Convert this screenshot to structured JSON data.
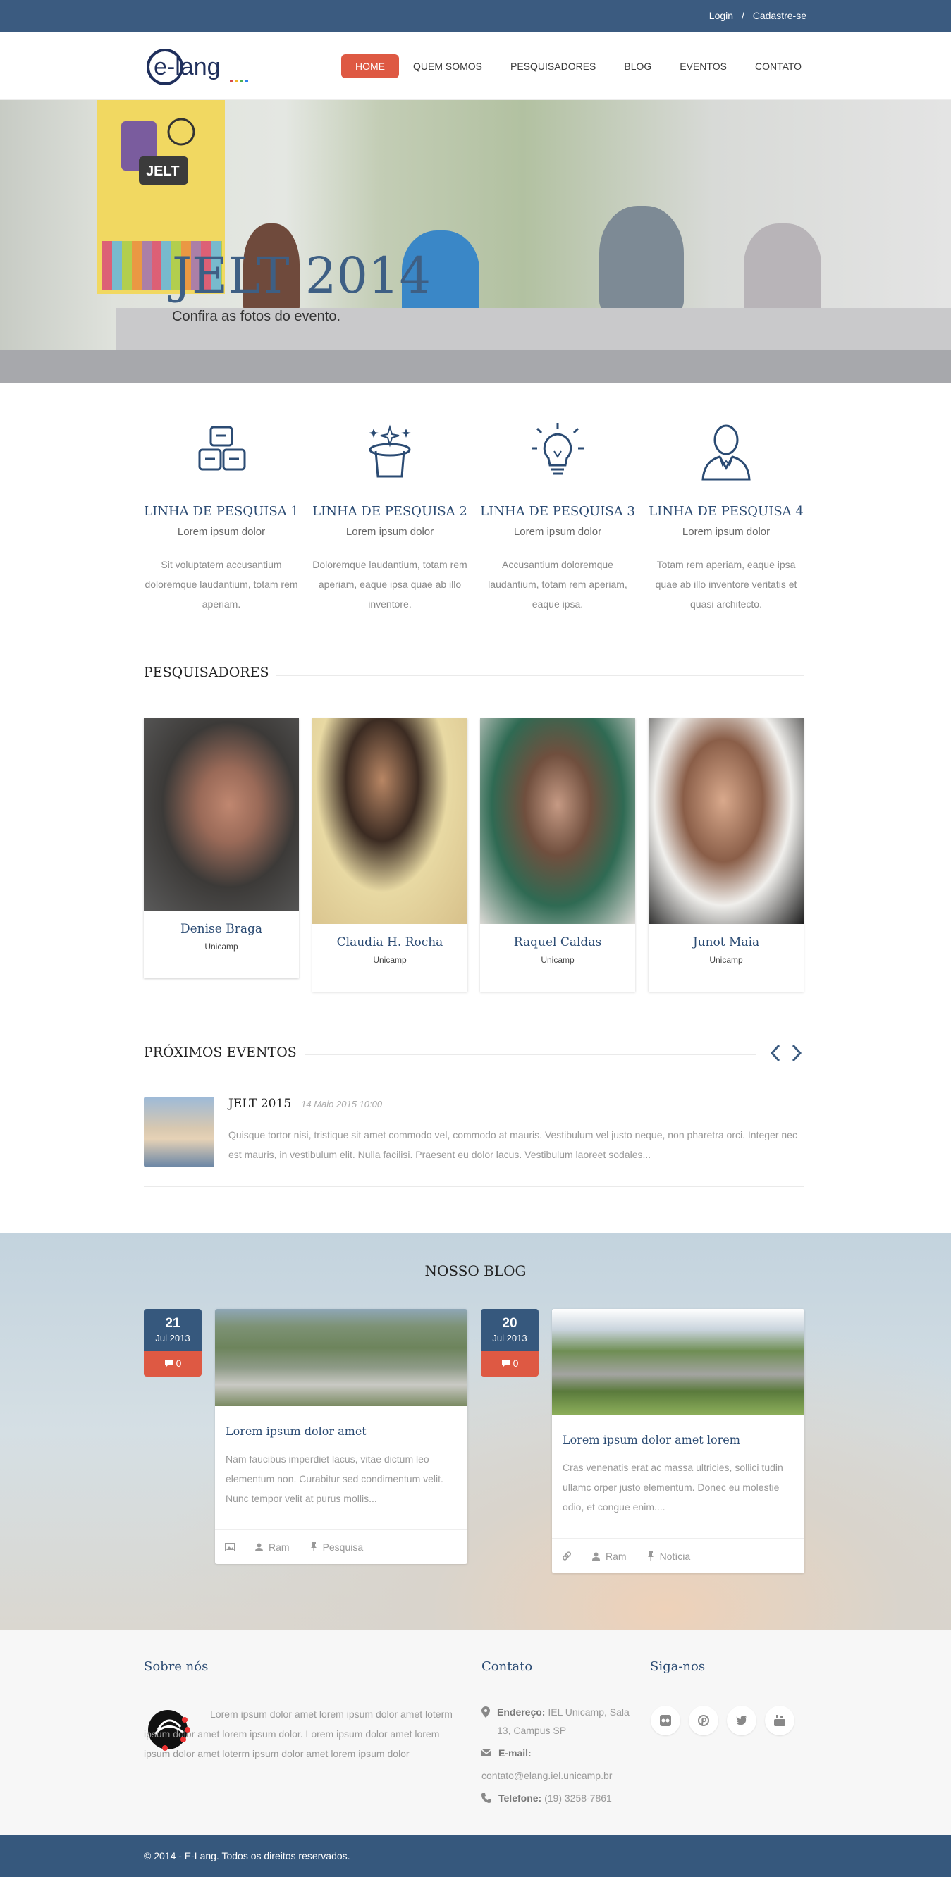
{
  "topbar": {
    "login": "Login",
    "separator": "/",
    "signup": "Cadastre-se"
  },
  "brand": {
    "logo_text": "e-lang"
  },
  "nav": {
    "items": [
      "HOME",
      "QUEM SOMOS",
      "PESQUISADORES",
      "BLOG",
      "EVENTOS",
      "CONTATO"
    ],
    "active": "HOME"
  },
  "hero": {
    "title": "JELT 2014",
    "subtitle": "Confira as fotos do evento.",
    "banner_text": "JELT"
  },
  "features": [
    {
      "icon": "blocks-icon",
      "title": "LINHA DE PESQUISA 1",
      "subtitle": "Lorem ipsum dolor",
      "text": "Sit voluptatem accusantium doloremque laudantium, totam rem aperiam."
    },
    {
      "icon": "magic-hat-icon",
      "title": "LINHA DE PESQUISA 2",
      "subtitle": "Lorem ipsum dolor",
      "text": "Doloremque laudantium, totam rem aperiam, eaque ipsa quae ab illo inventore."
    },
    {
      "icon": "lightbulb-icon",
      "title": "LINHA DE PESQUISA 3",
      "subtitle": "Lorem ipsum dolor",
      "text": "Accusantium doloremque laudantium, totam rem aperiam, eaque ipsa."
    },
    {
      "icon": "person-icon",
      "title": "LINHA DE PESQUISA 4",
      "subtitle": "Lorem ipsum dolor",
      "text": "Totam rem aperiam, eaque ipsa quae ab illo inventore veritatis et quasi architecto."
    }
  ],
  "researchers": {
    "title": "PESQUISADORES",
    "people": [
      {
        "name": "Denise Braga",
        "institution": "Unicamp"
      },
      {
        "name": "Claudia H. Rocha",
        "institution": "Unicamp"
      },
      {
        "name": "Raquel Caldas",
        "institution": "Unicamp"
      },
      {
        "name": "Junot Maia",
        "institution": "Unicamp"
      }
    ]
  },
  "events": {
    "title": "PRÓXIMOS EVENTOS",
    "items": [
      {
        "title": "JELT 2015",
        "date": "14 Maio 2015 10:00",
        "text": "Quisque tortor nisi, tristique sit amet commodo vel, commodo at mauris. Vestibulum vel justo neque, non pharetra orci. Integer nec est mauris, in vestibulum elit. Nulla facilisi. Praesent eu dolor lacus. Vestibulum laoreet sodales..."
      }
    ]
  },
  "blog": {
    "title": "NOSSO BLOG",
    "posts": [
      {
        "day": "21",
        "month": "Jul 2013",
        "comments": "0",
        "title": "Lorem ipsum dolor amet",
        "text": "Nam faucibus imperdiet lacus, vitae dictum leo elementum non. Curabitur sed condimentum velit. Nunc tempor velit at purus mollis...",
        "type_icon": "image-icon",
        "author": "Ram",
        "category": "Pesquisa"
      },
      {
        "day": "20",
        "month": "Jul 2013",
        "comments": "0",
        "title": "Lorem ipsum dolor amet lorem",
        "text": "Cras venenatis erat ac massa ultricies, sollici tudin ullamc orper justo elementum. Donec eu molestie odio, et congue enim....",
        "type_icon": "link-icon",
        "author": "Ram",
        "category": "Notícia"
      }
    ]
  },
  "footer": {
    "about_title": "Sobre nós",
    "about_text": "Lorem ipsum dolor amet lorem ipsum dolor amet loterm ipsum dolor amet lorem ipsum dolor. Lorem ipsum dolor amet lorem ipsum dolor amet loterm ipsum dolor amet lorem ipsum dolor",
    "contact_title": "Contato",
    "address_label": "Endereço:",
    "address": "IEL Unicamp, Sala 13, Campus SP",
    "email_label": "E-mail:",
    "email": "contato@elang.iel.unicamp.br",
    "phone_label": "Telefone:",
    "phone": "(19) 3258-7861",
    "social_title": "Siga-nos",
    "social": [
      "flickr-icon",
      "pinterest-icon",
      "twitter-icon",
      "youtube-icon"
    ]
  },
  "copyright": "© 2014 - E-Lang. Todos os direitos reservados.",
  "colors": {
    "primary": "#3b5b80",
    "accent": "#de5943",
    "heading": "#2b4b73"
  }
}
